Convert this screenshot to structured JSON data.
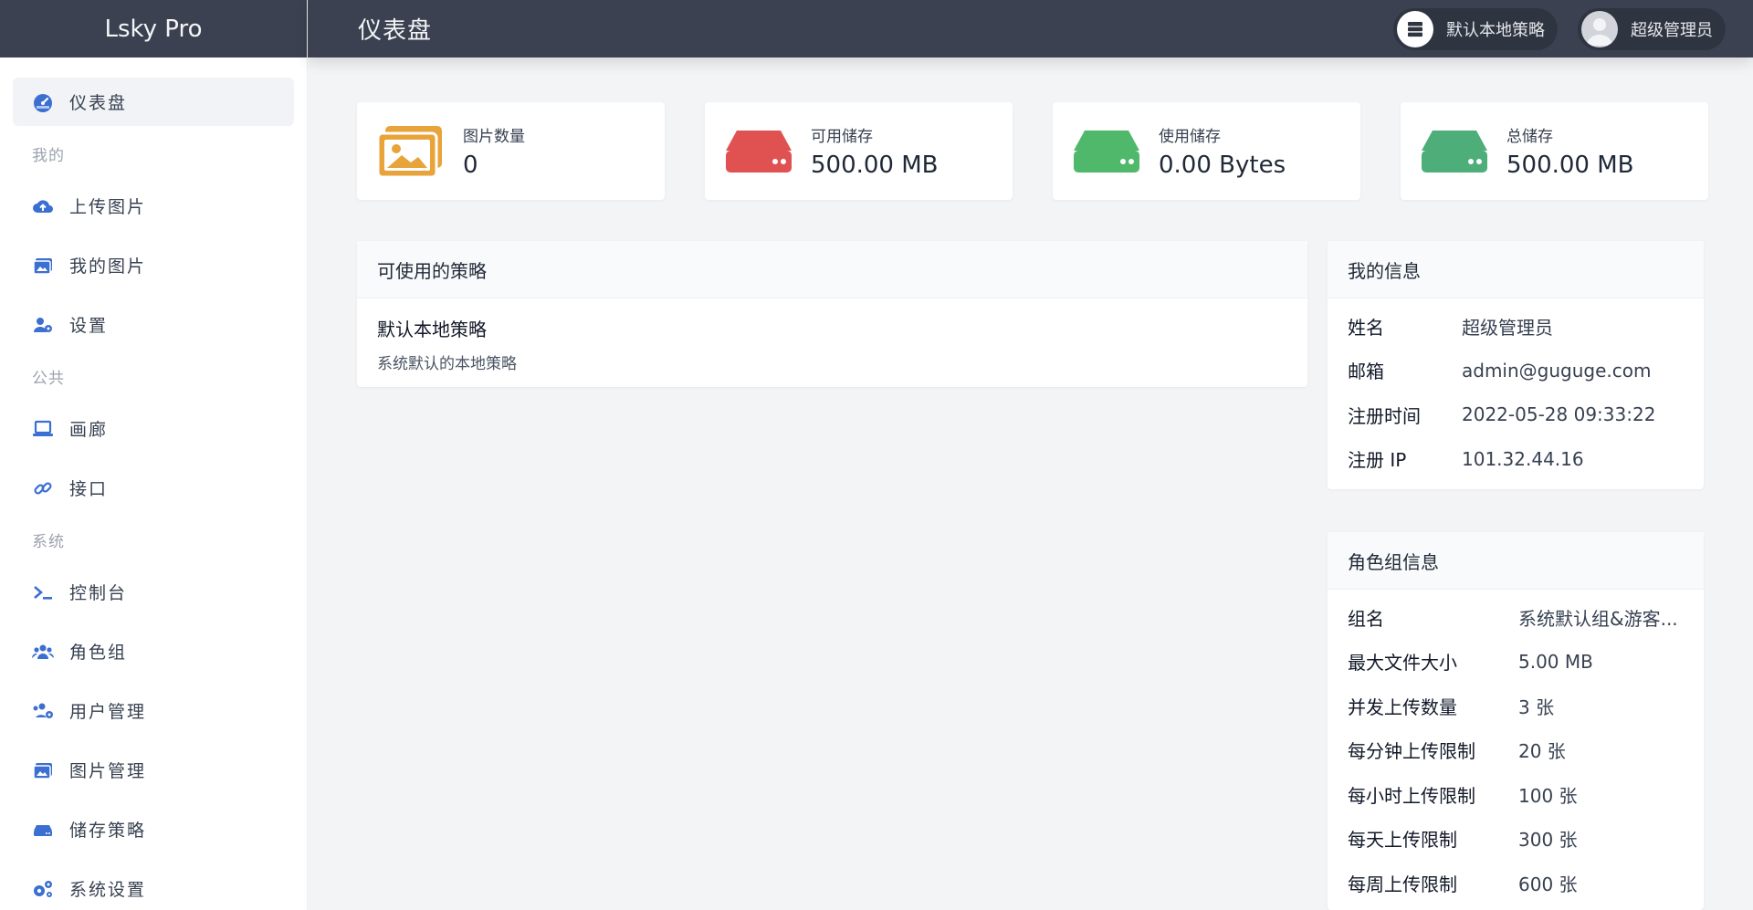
{
  "app": {
    "brand": "Lsky Pro"
  },
  "header": {
    "title": "仪表盘",
    "strategy_label": "默认本地策略",
    "user_label": "超级管理员"
  },
  "sidebar": {
    "items": [
      {
        "label": "仪表盘",
        "icon": "dashboard-icon",
        "active": true
      },
      {
        "group": "我的"
      },
      {
        "label": "上传图片",
        "icon": "cloud-upload-icon"
      },
      {
        "label": "我的图片",
        "icon": "images-icon"
      },
      {
        "label": "设置",
        "icon": "user-cog-icon"
      },
      {
        "group": "公共"
      },
      {
        "label": "画廊",
        "icon": "laptop-icon"
      },
      {
        "label": "接口",
        "icon": "link-icon"
      },
      {
        "group": "系统"
      },
      {
        "label": "控制台",
        "icon": "terminal-icon"
      },
      {
        "label": "角色组",
        "icon": "users-icon"
      },
      {
        "label": "用户管理",
        "icon": "users-cog-icon"
      },
      {
        "label": "图片管理",
        "icon": "images-icon"
      },
      {
        "label": "储存策略",
        "icon": "hdd-icon"
      },
      {
        "label": "系统设置",
        "icon": "cogs-icon"
      }
    ]
  },
  "stats": [
    {
      "label": "图片数量",
      "value": "0",
      "icon": "image-icon",
      "color": "#e8a33a"
    },
    {
      "label": "可用储存",
      "value": "500.00 MB",
      "icon": "hdd-icon",
      "color": "#e05252"
    },
    {
      "label": "使用储存",
      "value": "0.00 Bytes",
      "icon": "hdd-icon",
      "color": "#4fb86a"
    },
    {
      "label": "总储存",
      "value": "500.00 MB",
      "icon": "hdd-icon",
      "color": "#4dae7a"
    }
  ],
  "policies": {
    "title": "可使用的策略",
    "items": [
      {
        "name": "默认本地策略",
        "desc": "系统默认的本地策略"
      }
    ]
  },
  "my_info": {
    "title": "我的信息",
    "rows": [
      {
        "k": "姓名",
        "v": "超级管理员"
      },
      {
        "k": "邮箱",
        "v": "admin@guguge.com"
      },
      {
        "k": "注册时间",
        "v": "2022-05-28 09:33:22"
      },
      {
        "k": "注册 IP",
        "v": "101.32.44.16"
      }
    ]
  },
  "role_info": {
    "title": "角色组信息",
    "rows": [
      {
        "k": "组名",
        "v": "系统默认组&游客..."
      },
      {
        "k": "最大文件大小",
        "v": "5.00 MB"
      },
      {
        "k": "并发上传数量",
        "v": "3 张"
      },
      {
        "k": "每分钟上传限制",
        "v": "20 张"
      },
      {
        "k": "每小时上传限制",
        "v": "100 张"
      },
      {
        "k": "每天上传限制",
        "v": "300 张"
      },
      {
        "k": "每周上传限制",
        "v": "600 张"
      }
    ]
  },
  "colors": {
    "accent": "#3b82f6",
    "topbar": "#3b4150"
  }
}
